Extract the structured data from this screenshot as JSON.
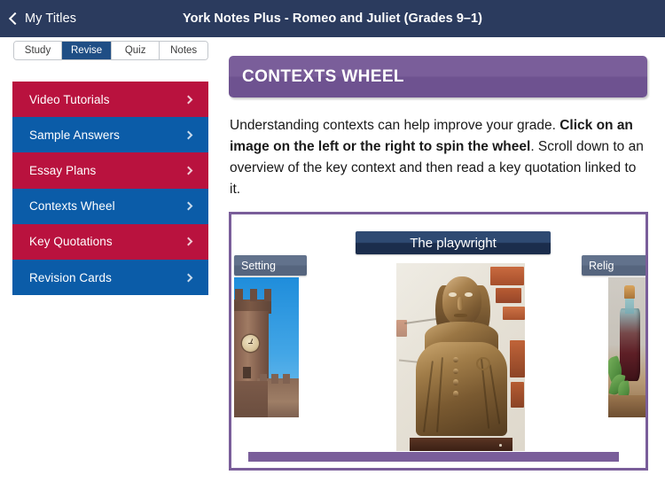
{
  "navbar": {
    "back_label": "My Titles",
    "back_icon": "chevron-left-icon",
    "title": "York Notes Plus - Romeo and Juliet (Grades 9–1)",
    "background_color": "#2b3b5e"
  },
  "tabs": {
    "items": [
      {
        "label": "Study",
        "active": false
      },
      {
        "label": "Revise",
        "active": true
      },
      {
        "label": "Quiz",
        "active": false
      },
      {
        "label": "Notes",
        "active": false
      }
    ],
    "active_color": "#1f4e85"
  },
  "sidebar": {
    "items": [
      {
        "label": "Video Tutorials",
        "color": "#b9123e",
        "chevron": "chevron-right-icon"
      },
      {
        "label": "Sample Answers",
        "color": "#0b5ca8",
        "chevron": "chevron-right-icon"
      },
      {
        "label": "Essay Plans",
        "color": "#b9123e",
        "chevron": "chevron-right-icon"
      },
      {
        "label": "Contexts Wheel",
        "color": "#0b5ca8",
        "chevron": "chevron-right-icon"
      },
      {
        "label": "Key Quotations",
        "color": "#b9123e",
        "chevron": "chevron-right-icon"
      },
      {
        "label": "Revision Cards",
        "color": "#0b5ca8",
        "chevron": "chevron-right-icon"
      }
    ]
  },
  "main": {
    "section_title": "CONTEXTS WHEEL",
    "section_color": "#7a5e9a",
    "intro": {
      "part1": "Understanding contexts can help improve your grade. ",
      "bold": "Click on an image on the left or the right to spin the wheel",
      "part2": ". Scroll down to an overview of the key context and then read a key quotation linked to it."
    },
    "wheel": {
      "border_color": "#7a5e9a",
      "center": {
        "label": "The playwright",
        "label_color": "#1b2d4c",
        "image_alt": "bronze-bust-of-shakespeare"
      },
      "left": {
        "label": "Setting",
        "label_color": "#56657e",
        "image_alt": "medieval-clock-tower"
      },
      "right": {
        "label": "Relig",
        "label_full": "Religion",
        "label_color": "#56657e",
        "image_alt": "potion-bottle-with-herbs"
      }
    }
  }
}
